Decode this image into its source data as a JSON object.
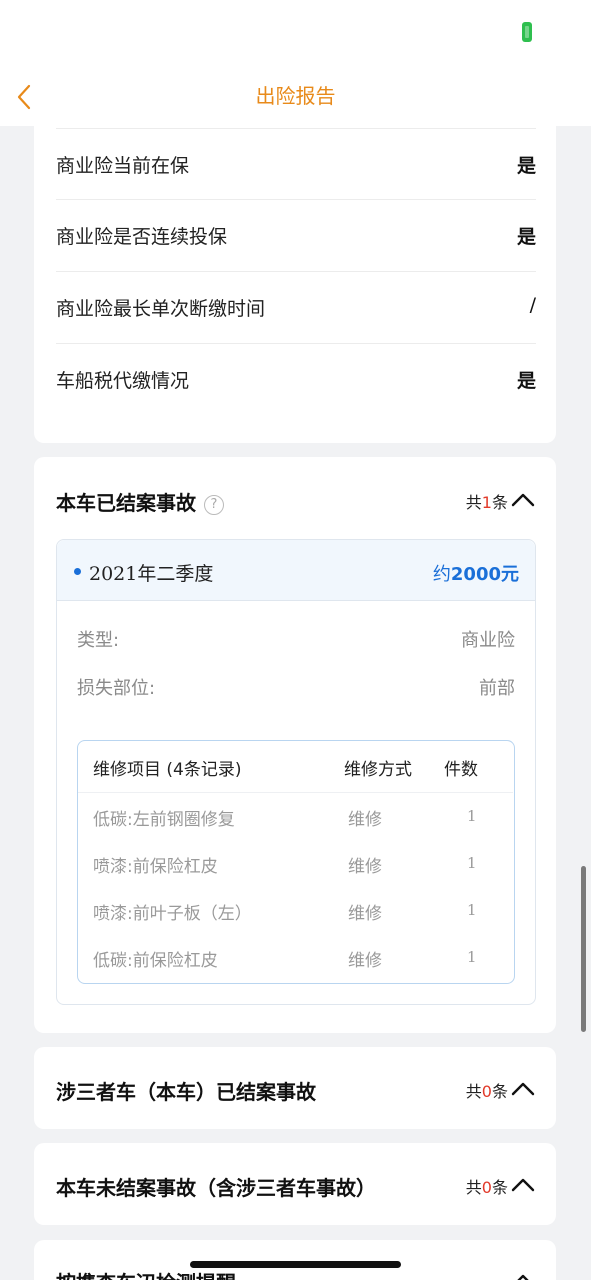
{
  "nav": {
    "title": "出险报告"
  },
  "insurance_status": {
    "rows": [
      {
        "label": "商业险当前在保",
        "value": "是"
      },
      {
        "label": "商业险是否连续投保",
        "value": "是"
      },
      {
        "label": "商业险最长单次断缴时间",
        "value": "/"
      },
      {
        "label": "车船税代缴情况",
        "value": "是"
      }
    ]
  },
  "settled": {
    "title": "本车已结案事故",
    "count_prefix": "共",
    "count": "1",
    "count_suffix": "条",
    "accident": {
      "period": "2021年二季度",
      "amount_prefix": "约",
      "amount": "2000元",
      "type_label": "类型:",
      "type_value": "商业险",
      "part_label": "损失部位:",
      "part_value": "前部",
      "table": {
        "headers": [
          "维修项目 (4条记录)",
          "维修方式",
          "件数"
        ],
        "rows": [
          {
            "item": "低碳:左前钢圈修复",
            "method": "维修",
            "qty": "1"
          },
          {
            "item": "喷漆:前保险杠皮",
            "method": "维修",
            "qty": "1"
          },
          {
            "item": "喷漆:前叶子板（左）",
            "method": "维修",
            "qty": "1"
          },
          {
            "item": "低碳:前保险杠皮",
            "method": "维修",
            "qty": "1"
          }
        ]
      }
    }
  },
  "third_party": {
    "title": "涉三者车（本车）已结案事故",
    "count_prefix": "共",
    "count": "0",
    "count_suffix": "条"
  },
  "unsettled": {
    "title": "本车未结案事故（含涉三者车事故）",
    "count_prefix": "共",
    "count": "0",
    "count_suffix": "条"
  },
  "cutoff": {
    "title": "按携查车辺检测提醒"
  }
}
